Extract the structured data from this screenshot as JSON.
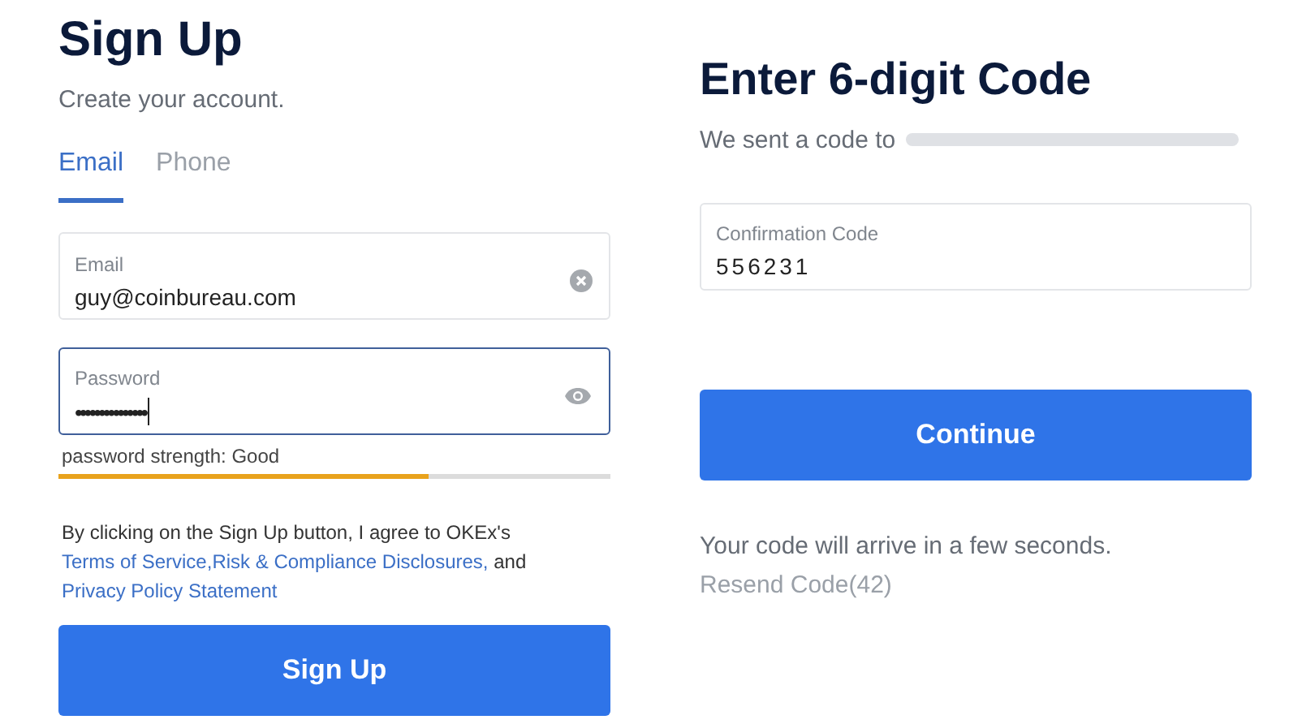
{
  "signup": {
    "title": "Sign Up",
    "subtitle": "Create your account.",
    "tabs": [
      {
        "label": "Email",
        "selected": true
      },
      {
        "label": "Phone",
        "selected": false
      }
    ],
    "email_field": {
      "label": "Email",
      "value": "guy@coinbureau.com"
    },
    "password_field": {
      "label": "Password",
      "value": "•••••••••••••••",
      "focused": true
    },
    "strength": {
      "text": "password strength: Good",
      "level": 0.67
    },
    "terms": [
      {
        "kind": "text",
        "text": "By clicking on the Sign Up button, I agree to OKEx's "
      },
      {
        "kind": "link",
        "text": "Terms of Service,"
      },
      {
        "kind": "link",
        "text": "Risk & Compliance Disclosures,"
      },
      {
        "kind": "text",
        "text": " and "
      },
      {
        "kind": "link",
        "text": "Privacy Policy Statement"
      }
    ],
    "button": "Sign Up"
  },
  "verify": {
    "title": "Enter 6-digit Code",
    "sent_text": "We sent a code to",
    "code_field": {
      "label": "Confirmation Code",
      "value": "556231"
    },
    "button": "Continue",
    "info": "Your code will arrive in a few seconds.",
    "resend": "Resend Code(42)"
  }
}
